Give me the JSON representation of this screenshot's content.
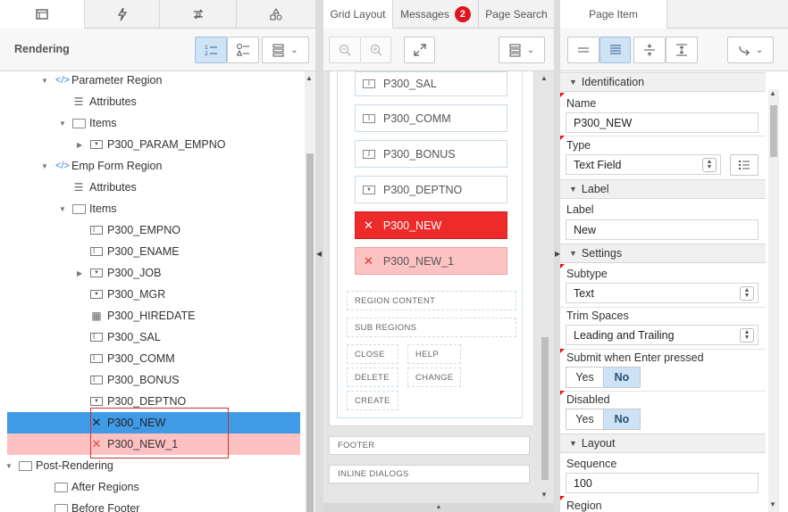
{
  "left": {
    "title": "Rendering",
    "tabs": [
      "page-icon",
      "lightning-icon",
      "shared-components-icon",
      "shapes-icon"
    ],
    "tree": [
      {
        "label": "Parameter Region",
        "icon": "region-code-icon",
        "level": 1,
        "expanded": true
      },
      {
        "label": "Attributes",
        "icon": "attributes-icon",
        "level": 2
      },
      {
        "label": "Items",
        "icon": "folder-icon",
        "level": 2,
        "expanded": true
      },
      {
        "label": "P300_PARAM_EMPNO",
        "icon": "select-list-icon",
        "level": 3,
        "collapsed": true
      },
      {
        "label": "Emp Form Region",
        "icon": "region-code-icon",
        "level": 1,
        "expanded": true
      },
      {
        "label": "Attributes",
        "icon": "attributes-icon",
        "level": 2
      },
      {
        "label": "Items",
        "icon": "folder-icon",
        "level": 2,
        "expanded": true
      },
      {
        "label": "P300_EMPNO",
        "icon": "text-field-icon",
        "level": 3
      },
      {
        "label": "P300_ENAME",
        "icon": "text-field-icon",
        "level": 3
      },
      {
        "label": "P300_JOB",
        "icon": "select-list-icon",
        "level": 3,
        "collapsed": true
      },
      {
        "label": "P300_MGR",
        "icon": "select-list-icon",
        "level": 3
      },
      {
        "label": "P300_HIREDATE",
        "icon": "date-picker-icon",
        "level": 3
      },
      {
        "label": "P300_SAL",
        "icon": "text-field-icon",
        "level": 3
      },
      {
        "label": "P300_COMM",
        "icon": "text-field-icon",
        "level": 3
      },
      {
        "label": "P300_BONUS",
        "icon": "text-field-icon",
        "level": 3
      },
      {
        "label": "P300_DEPTNO",
        "icon": "select-list-icon",
        "level": 3
      },
      {
        "label": "P300_NEW",
        "icon": "error-x-icon",
        "level": 3,
        "state": "selected"
      },
      {
        "label": "P300_NEW_1",
        "icon": "error-x-icon",
        "level": 3,
        "state": "error"
      },
      {
        "label": "Post-Rendering",
        "icon": "folder-icon",
        "level": 0,
        "expanded": true
      },
      {
        "label": "After Regions",
        "icon": "folder-icon",
        "level": 1
      },
      {
        "label": "Before Footer",
        "icon": "folder-icon",
        "level": 1
      }
    ]
  },
  "middle": {
    "tabs": [
      {
        "label": "Grid Layout"
      },
      {
        "label": "Messages",
        "badge": "2"
      },
      {
        "label": "Page Search"
      }
    ],
    "items": [
      {
        "label": "P300_SAL",
        "icon": "text-field-icon"
      },
      {
        "label": "P300_COMM",
        "icon": "text-field-icon"
      },
      {
        "label": "P300_BONUS",
        "icon": "text-field-icon"
      },
      {
        "label": "P300_DEPTNO",
        "icon": "select-list-icon"
      },
      {
        "label": "P300_NEW",
        "icon": "error-x-icon",
        "state": "selected"
      },
      {
        "label": "P300_NEW_1",
        "icon": "error-x-icon",
        "state": "error"
      }
    ],
    "region_content": "REGION CONTENT",
    "sub_regions": "SUB REGIONS",
    "buttons": [
      "CLOSE",
      "HELP",
      "DELETE",
      "CHANGE",
      "CREATE"
    ],
    "footer": "FOOTER",
    "inline_dialogs": "INLINE DIALOGS"
  },
  "right": {
    "tab": "Page Item",
    "identification": {
      "header": "Identification",
      "name_label": "Name",
      "name_value": "P300_NEW",
      "type_label": "Type",
      "type_value": "Text Field"
    },
    "label_group": {
      "header": "Label",
      "label_label": "Label",
      "label_value": "New"
    },
    "settings": {
      "header": "Settings",
      "subtype_label": "Subtype",
      "subtype_value": "Text",
      "trim_label": "Trim Spaces",
      "trim_value": "Leading and Trailing",
      "submit_label": "Submit when Enter pressed",
      "submit_yes": "Yes",
      "submit_no": "No",
      "disabled_label": "Disabled",
      "disabled_yes": "Yes",
      "disabled_no": "No"
    },
    "layout": {
      "header": "Layout",
      "sequence_label": "Sequence",
      "sequence_value": "100",
      "region_label": "Region"
    }
  },
  "colors": {
    "selected": "#3f9be6",
    "error_row": "#fec1c1",
    "error_item": "#ee2b2b",
    "toggle_on": "#cde2f5"
  }
}
